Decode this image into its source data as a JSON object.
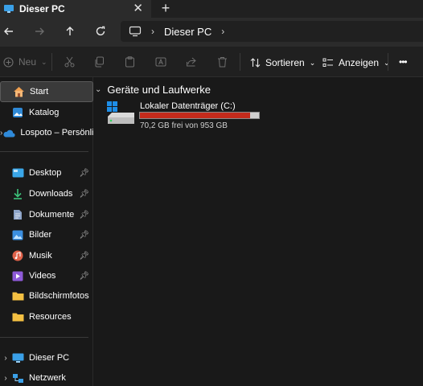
{
  "window": {
    "tab_title": "Dieser PC",
    "tab_close": "✕",
    "new_tab": "+"
  },
  "address": {
    "crumb": "Dieser PC",
    "chevron": "›"
  },
  "command_bar": {
    "new_label": "Neu",
    "sort_label": "Sortieren",
    "view_label": "Anzeigen",
    "more": "•••"
  },
  "sidebar": {
    "items": [
      {
        "label": "Start",
        "icon": "home-icon"
      },
      {
        "label": "Katalog",
        "icon": "gallery-icon"
      },
      {
        "label": "Lospoto – Persönlic",
        "icon": "onedrive-cloud-icon"
      },
      {
        "label": "Desktop",
        "icon": "desktop-icon"
      },
      {
        "label": "Downloads",
        "icon": "download-icon"
      },
      {
        "label": "Dokumente",
        "icon": "document-icon"
      },
      {
        "label": "Bilder",
        "icon": "pictures-icon"
      },
      {
        "label": "Musik",
        "icon": "music-icon"
      },
      {
        "label": "Videos",
        "icon": "videos-icon"
      },
      {
        "label": "Bildschirmfotos",
        "icon": "folder-icon"
      },
      {
        "label": "Resources",
        "icon": "folder-icon"
      },
      {
        "label": "Dieser PC",
        "icon": "this-pc-icon"
      },
      {
        "label": "Netzwerk",
        "icon": "network-icon"
      }
    ]
  },
  "main": {
    "group_title": "Geräte und Laufwerke",
    "drives": [
      {
        "name": "Lokaler Datenträger (C:)",
        "free_text": "70,2 GB frei von 953 GB",
        "used_fraction": 0.926
      }
    ]
  },
  "colors": {
    "accent_bar": "#c42b1c",
    "selection": "#3a3a3a"
  }
}
